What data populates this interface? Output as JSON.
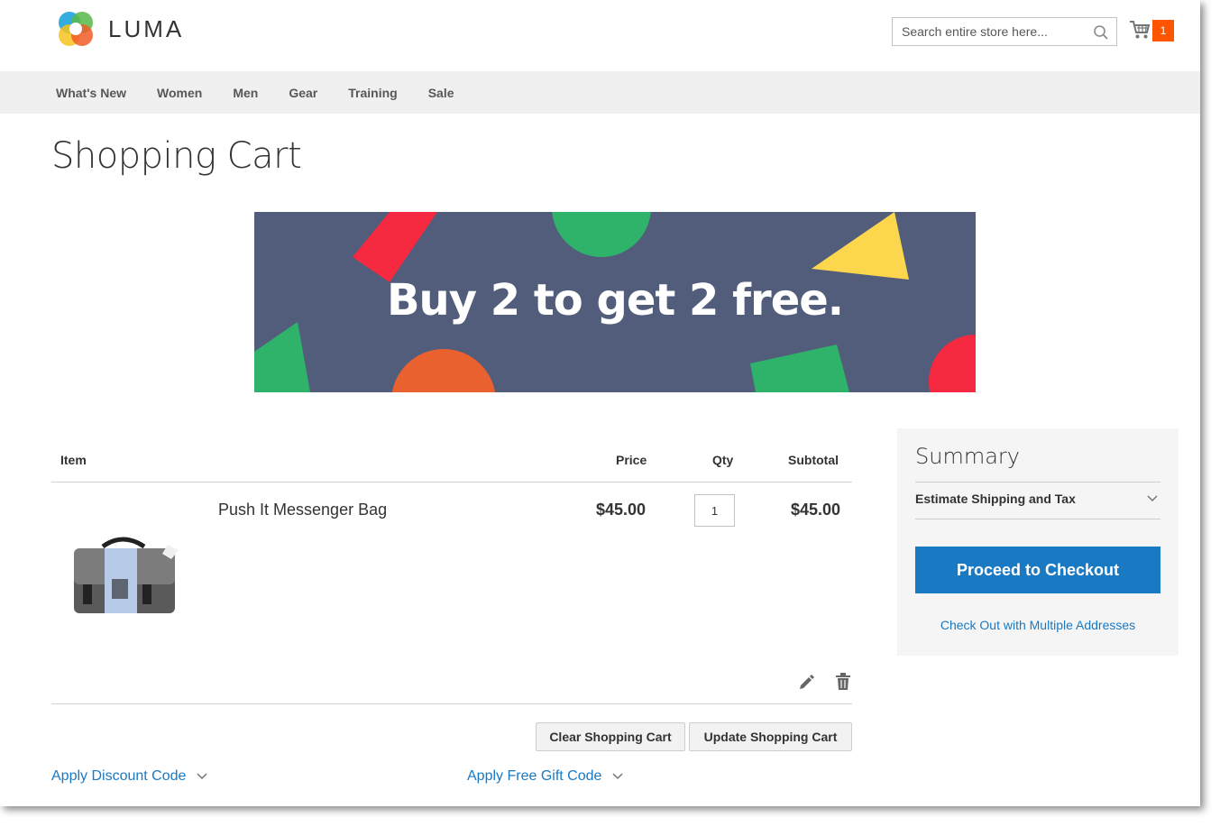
{
  "header": {
    "logo_text": "LUMA",
    "search": {
      "placeholder": "Search entire store here..."
    },
    "cart_count": "1"
  },
  "nav": {
    "items": [
      "What's New",
      "Women",
      "Men",
      "Gear",
      "Training",
      "Sale"
    ]
  },
  "page_title": "Shopping Cart",
  "banner": {
    "text": "Buy 2 to get 2 free."
  },
  "cart": {
    "headers": {
      "item": "Item",
      "price": "Price",
      "qty": "Qty",
      "subtotal": "Subtotal"
    },
    "items": [
      {
        "name": "Push It Messenger Bag",
        "price": "$45.00",
        "qty": "1",
        "subtotal": "$45.00"
      }
    ],
    "clear_label": "Clear Shopping Cart",
    "update_label": "Update Shopping Cart",
    "discount_label": "Apply Discount Code",
    "gift_label": "Apply Free Gift Code"
  },
  "summary": {
    "title": "Summary",
    "estimate_label": "Estimate Shipping and Tax",
    "checkout_label": "Proceed to Checkout",
    "multi_label": "Check Out with Multiple Addresses"
  },
  "colors": {
    "accent": "#1979c3",
    "cart_badge": "#ff5501",
    "banner_bg": "#525d7b",
    "nav_bg": "#f0f0f0"
  }
}
